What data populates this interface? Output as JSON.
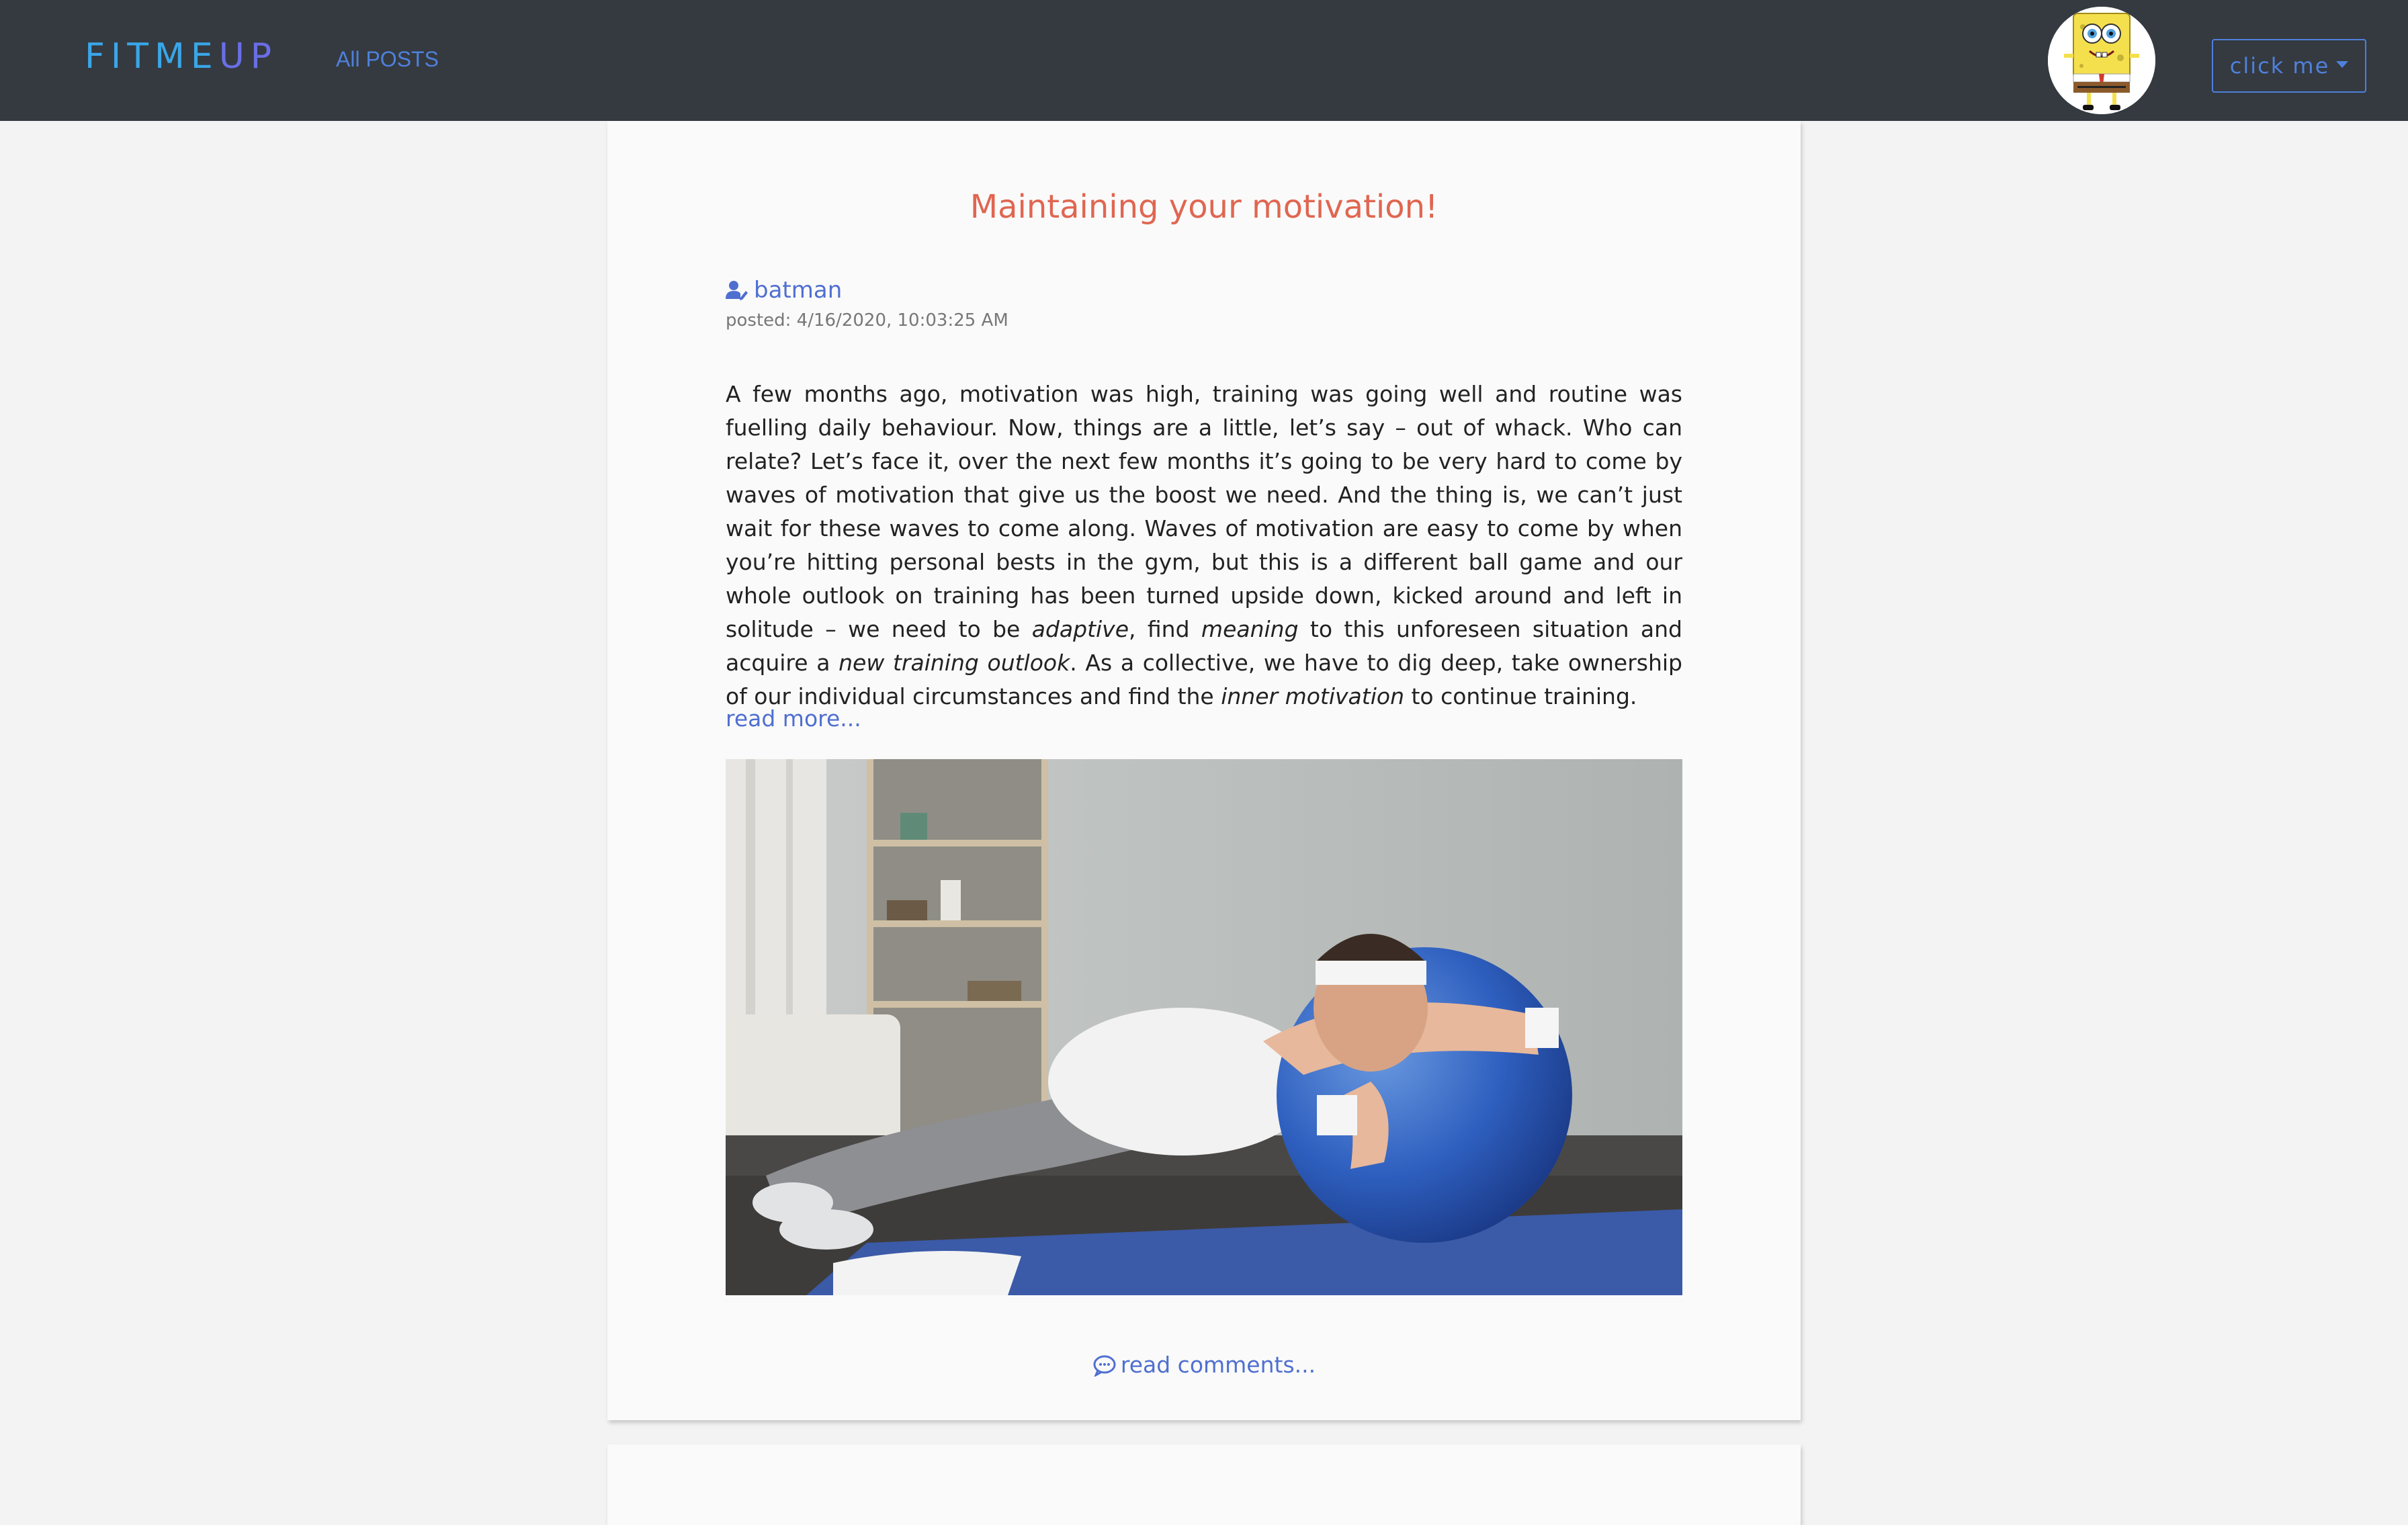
{
  "nav": {
    "brand_part1": "FITME",
    "brand_part2": "UP",
    "all_posts": "All POSTS",
    "avatar_icon": "spongebob-avatar",
    "dropdown_label": "click me"
  },
  "post": {
    "title": "Maintaining your motivation!",
    "author": "batman",
    "posted": "posted: 4/16/2020, 10:03:25 AM",
    "body": {
      "t1": "A few months ago, motivation was high, training was going well and routine was fuelling daily behaviour. Now, things are a little, let’s say – out of whack. Who can relate? Let’s face it, over the next few months it’s going to be very hard to come by waves of motivation that give us the boost we need. And the thing is, we can’t just wait for these waves to come along. Waves of motivation are easy to come by when you’re hitting personal bests in the gym, but this is a different ball game and our whole outlook on training has been turned upside down, kicked around and left in solitude – we need to be ",
      "e1": "adaptive",
      "t2": ", find ",
      "e2": "meaning",
      "t3": " to this unforeseen situation and acquire a ",
      "e3": "new training outlook",
      "t4": ". As a collective, we have to dig deep, take ownership of our individual circumstances and find the ",
      "e4": "inner motivation",
      "t5": " to continue training."
    },
    "read_more": "read more...",
    "image_icon": "man-on-exercise-ball-photo",
    "comments": "read comments..."
  },
  "colors": {
    "navbar": "#343a40",
    "accent": "#4f6fd0",
    "title": "#e06651"
  }
}
